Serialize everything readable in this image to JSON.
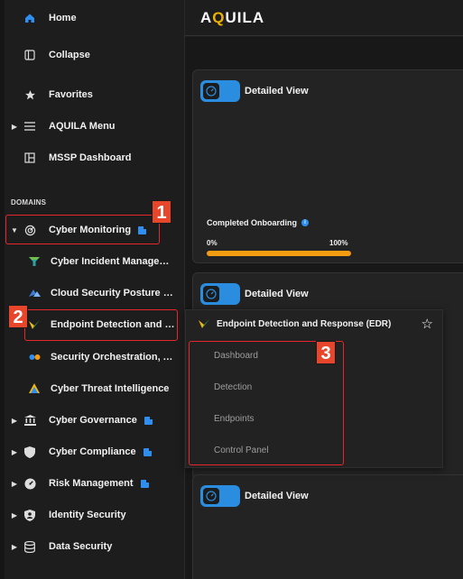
{
  "app": {
    "logo": "AQUILA"
  },
  "sidebar": {
    "home": "Home",
    "collapse": "Collapse",
    "favorites": "Favorites",
    "aquila_menu": "AQUILA Menu",
    "mssp_dashboard": "MSSP Dashboard",
    "domains_label": "DOMAINS",
    "cyber_monitoring": "Cyber Monitoring",
    "cm_items": [
      "Cyber Incident Management",
      "Cloud Security Posture Management",
      "Endpoint Detection and Response",
      "Security Orchestration, Automation",
      "Cyber Threat Intelligence"
    ],
    "cyber_governance": "Cyber Governance",
    "cyber_compliance": "Cyber Compliance",
    "risk_management": "Risk Management",
    "identity_security": "Identity Security",
    "data_security": "Data Security"
  },
  "cards": [
    {
      "title": "Detailed View",
      "onboarding_label": "Completed Onboarding",
      "progress_min": "0%",
      "progress_max": "100%",
      "progress_value": 1.0
    },
    {
      "title": "Detailed View"
    },
    {
      "title": "Detailed View"
    }
  ],
  "popup": {
    "title": "Endpoint Detection and Response (EDR)",
    "items": [
      "Dashboard",
      "Detection",
      "Endpoints",
      "Control Panel"
    ]
  },
  "annotations": [
    "1",
    "2",
    "3"
  ],
  "colors": {
    "accent": "#2a8de0",
    "highlight": "#e8262b",
    "progress": "#f39c12",
    "logo_q": "#f0b400"
  }
}
